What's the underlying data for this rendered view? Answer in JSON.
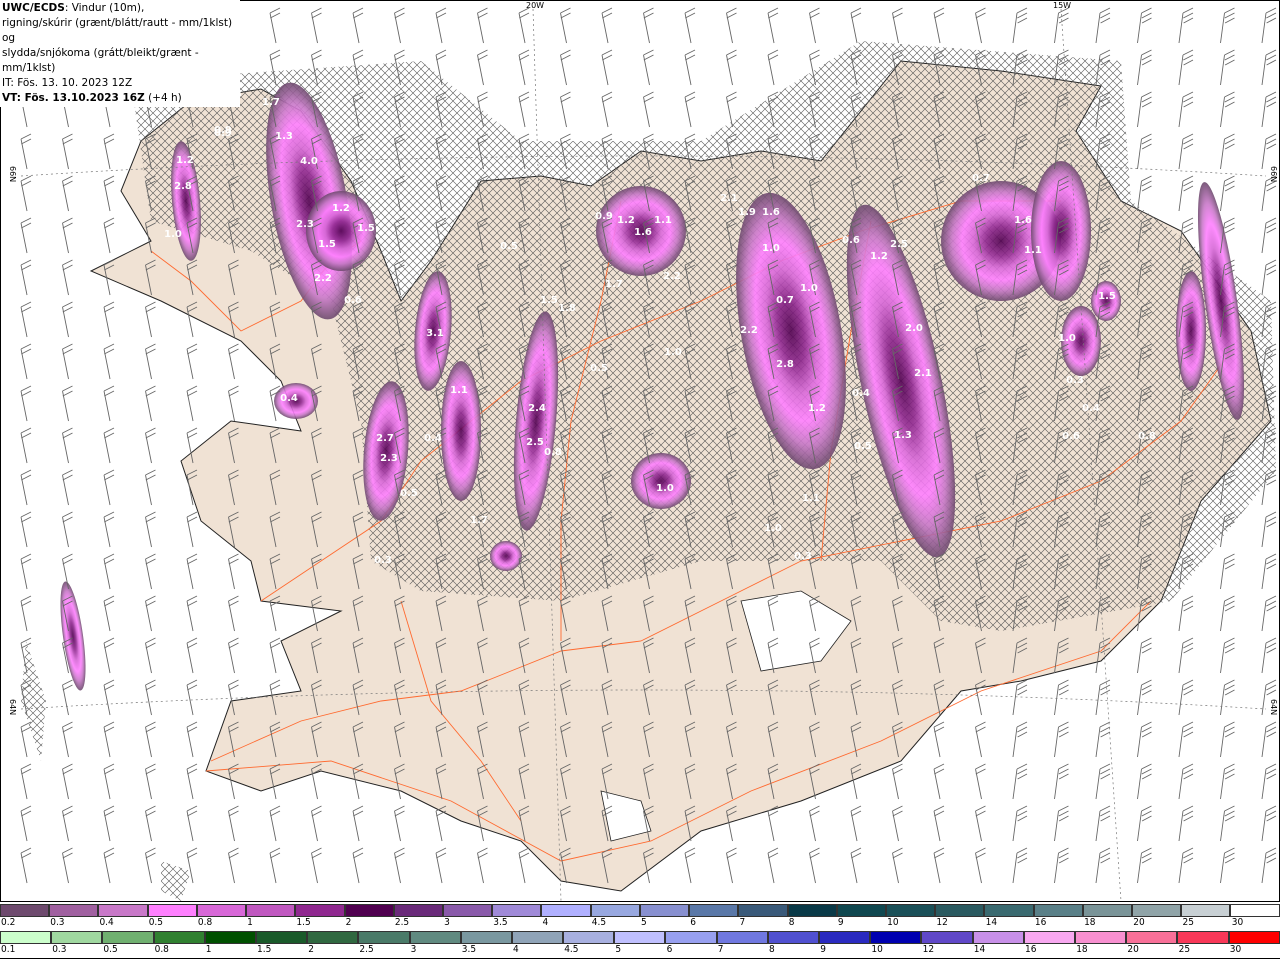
{
  "header": {
    "model": "UWC/ECDS",
    "line1_rest": ": Vindur (10m),",
    "line2": "rigning/skúrir (grænt/blátt/rautt - mm/1klst) og",
    "line3": "slydda/snjókoma (grátt/bleikt/grænt - mm/1klst)",
    "init_time": "IT: Fös. 13. 10. 2023 12Z",
    "valid_time": "VT: Fös. 13.10.2023 16Z",
    "lead": "(+4 h)"
  },
  "map": {
    "land_color": "#f0e2d4",
    "road_color": "#ff6a30",
    "coord_labels": {
      "lon_20w": "20W",
      "lon_15w": "15W",
      "lat_66n_left": "66N",
      "lat_66n_right": "66N",
      "lat_64n_left": "64N",
      "lat_64n_right": "64N"
    },
    "value_labels": [
      "0.9",
      "0.8",
      "0.4",
      "0.9",
      "1.7",
      "1.3",
      "4.0",
      "1.2",
      "2.8",
      "1.2",
      "2.3",
      "1.5",
      "1.0",
      "1.5",
      "2.2",
      "0.6",
      "3.1",
      "0.4",
      "2.7",
      "2.3",
      "0.4",
      "0.5",
      "1.1",
      "0.5",
      "1.5",
      "1.8",
      "2.4",
      "2.5",
      "0.8",
      "0.5",
      "0.9",
      "1.2",
      "1.6",
      "1.1",
      "2.2",
      "1.7",
      "1.0",
      "1.0",
      "2.1",
      "1.9",
      "1.6",
      "1.0",
      "2.2",
      "2.8",
      "0.7",
      "1.0",
      "1.2",
      "0.6",
      "1.2",
      "2.5",
      "2.0",
      "2.1",
      "1.3",
      "0.5",
      "0.4",
      "0.7",
      "1.6",
      "1.1",
      "1.5",
      "1.0",
      "0.3",
      "0.4",
      "0.6",
      "0.8",
      "1.0",
      "0.3",
      "1.1",
      "0.5",
      "1.7",
      "0.3"
    ]
  },
  "legend": {
    "snow": {
      "labels": [
        "0.2",
        "0.3",
        "0.4",
        "0.5",
        "0.8",
        "1",
        "1.5",
        "2",
        "2.5",
        "3",
        "3.5",
        "4",
        "4.5",
        "5",
        "6",
        "7",
        "8",
        "9",
        "10",
        "12",
        "14",
        "16",
        "18",
        "20",
        "25",
        "30"
      ],
      "colors": [
        "#6e4a6e",
        "#a060a0",
        "#c878c8",
        "#ff80ff",
        "#d868d8",
        "#c058c0",
        "#902890",
        "#500050",
        "#6a2a7a",
        "#8a5aaa",
        "#a08ad8",
        "#b0b0ff",
        "#98a8e0",
        "#8890d0",
        "#5a78a8",
        "#3a5a7a",
        "#0a3a48",
        "#104850",
        "#1a5058",
        "#2a5a60",
        "#3a6a70",
        "#5a8088",
        "#7a9498",
        "#90a4a8",
        "#c8d0d4",
        "#ffffff"
      ]
    },
    "rain": {
      "labels": [
        "0.1",
        "0.3",
        "0.5",
        "0.8",
        "1",
        "1.5",
        "2",
        "2.5",
        "3",
        "3.5",
        "4",
        "4.5",
        "5",
        "6",
        "7",
        "8",
        "9",
        "10",
        "12",
        "14",
        "16",
        "18",
        "20",
        "25",
        "30"
      ],
      "colors": [
        "#ccffcc",
        "#a0d8a0",
        "#70b070",
        "#308030",
        "#005000",
        "#1a5a2a",
        "#306840",
        "#4a7a68",
        "#608a80",
        "#7a98a0",
        "#90a4b8",
        "#a8b0e0",
        "#c0c0ff",
        "#98a0f0",
        "#7078e0",
        "#5050d0",
        "#2a2ac0",
        "#0000b0",
        "#6048c8",
        "#c890e8",
        "#f8a8f0",
        "#f890d0",
        "#f87098",
        "#f83858",
        "#ff0000"
      ]
    }
  }
}
